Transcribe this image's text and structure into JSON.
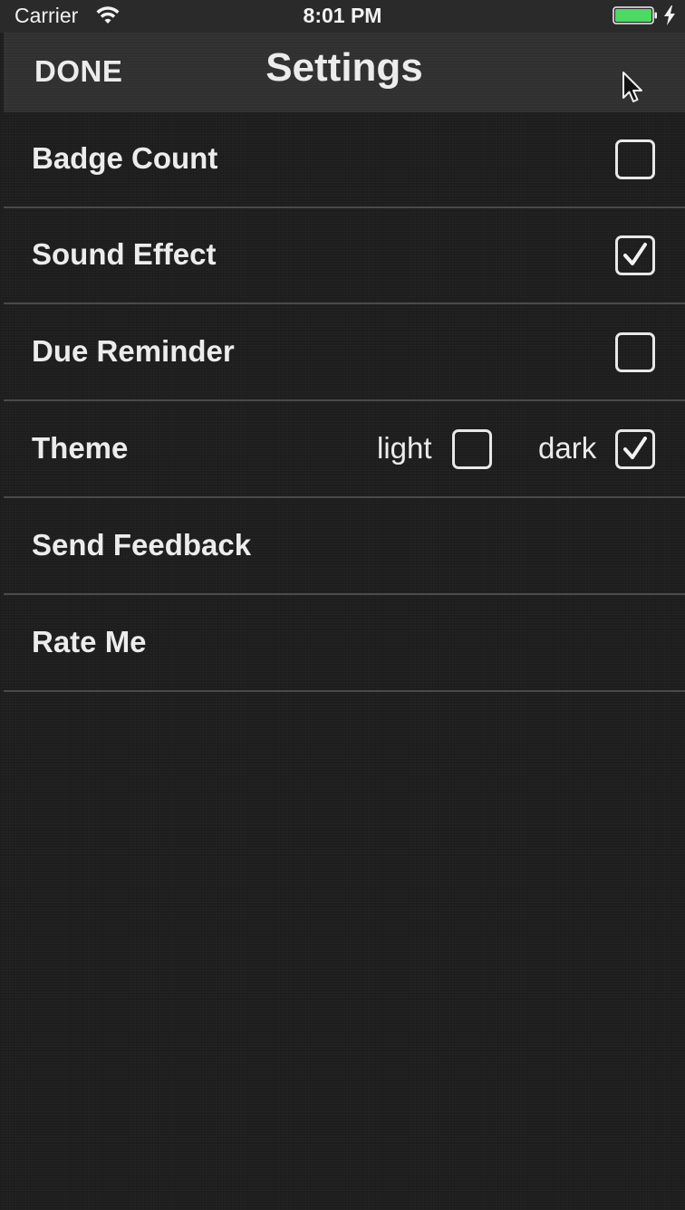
{
  "status_bar": {
    "carrier": "Carrier",
    "time": "8:01 PM",
    "wifi_icon": "wifi-icon",
    "battery_icon": "battery-icon",
    "charging_icon": "charging-bolt-icon",
    "battery_color": "#4cd964"
  },
  "nav": {
    "done_label": "DONE",
    "title": "Settings",
    "cursor_icon": "mouse-pointer-icon"
  },
  "settings": {
    "badge_count": {
      "label": "Badge Count",
      "checked": false
    },
    "sound_effect": {
      "label": "Sound Effect",
      "checked": true
    },
    "due_reminder": {
      "label": "Due Reminder",
      "checked": false
    },
    "theme": {
      "label": "Theme",
      "options": [
        {
          "label": "light",
          "checked": false
        },
        {
          "label": "dark",
          "checked": true
        }
      ]
    },
    "send_feedback": {
      "label": "Send Feedback"
    },
    "rate_me": {
      "label": "Rate Me"
    }
  },
  "colors": {
    "background": "#1f1f1f",
    "nav_background": "#303030",
    "text": "#ececec",
    "divider": "#4a4a4a"
  }
}
